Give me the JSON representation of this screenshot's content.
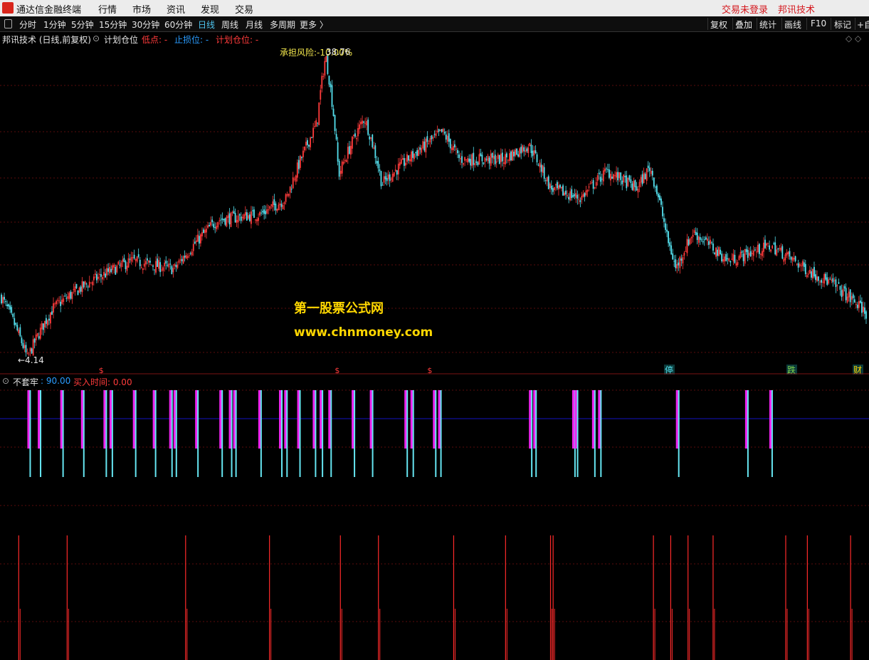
{
  "menubar": {
    "app_title": "通达信金融终端",
    "items": [
      "行情",
      "市场",
      "资讯",
      "发现",
      "交易"
    ],
    "right_items": [
      "交易未登录",
      "邦讯技术"
    ]
  },
  "toolbar": {
    "periods": [
      "分时",
      "1分钟",
      "5分钟",
      "15分钟",
      "30分钟",
      "60分钟",
      "日线",
      "周线",
      "月线",
      "多周期",
      "更多 〉"
    ],
    "active_period": "日线",
    "buttons": [
      "复权",
      "叠加",
      "统计",
      "画线",
      "F10",
      "标记",
      "+自"
    ]
  },
  "infobar": {
    "title": "邦讯技术 (日线,前复权)",
    "indicator": "计划仓位",
    "low_label": "低点: -",
    "stop_label": "止损位: -",
    "plan_label": "计划仓位: -",
    "diamonds": "◇ ◇"
  },
  "annotations": {
    "risk": "承担风险:-10.00%",
    "high_price": "38.76",
    "low_price": "←4.14",
    "watermark_line1": "第一股票公式网",
    "watermark_line2": "www.chnmoney.com",
    "signal_s": "$",
    "signal_labels": [
      "停",
      "跌",
      "财"
    ]
  },
  "indicator_panel": {
    "name": "不套牢",
    "value": ": 90.00",
    "buy_label": "买入时间: 0.00"
  },
  "colors": {
    "up": "#ff3b3b",
    "down": "#54e0ee",
    "magenta": "#ee22ee",
    "cyan": "#66e6f2",
    "red_spike": "#ff2a2a",
    "grid": "#5a0b0b",
    "blue_line": "#1414c0",
    "annotation_yellow": "#f2e64c"
  },
  "chart_data": {
    "type": "candlestick",
    "price_high": 38.76,
    "price_low": 4.14,
    "trend_keypoints": [
      [
        0,
        6.5
      ],
      [
        0.03,
        4.14
      ],
      [
        0.06,
        6.0
      ],
      [
        0.1,
        7.2
      ],
      [
        0.15,
        8.5
      ],
      [
        0.2,
        8.0
      ],
      [
        0.25,
        11.5
      ],
      [
        0.3,
        12.0
      ],
      [
        0.33,
        13.5
      ],
      [
        0.35,
        19.0
      ],
      [
        0.365,
        23.5
      ],
      [
        0.375,
        38.76
      ],
      [
        0.39,
        16.0
      ],
      [
        0.42,
        24.5
      ],
      [
        0.44,
        15.0
      ],
      [
        0.47,
        18.0
      ],
      [
        0.51,
        22.0
      ],
      [
        0.53,
        18.0
      ],
      [
        0.58,
        18.0
      ],
      [
        0.61,
        20.0
      ],
      [
        0.635,
        14.5
      ],
      [
        0.67,
        13.5
      ],
      [
        0.7,
        16.5
      ],
      [
        0.735,
        14.5
      ],
      [
        0.75,
        17.0
      ],
      [
        0.77,
        10.0
      ],
      [
        0.78,
        8.0
      ],
      [
        0.8,
        10.5
      ],
      [
        0.82,
        9.5
      ],
      [
        0.84,
        8.5
      ],
      [
        0.89,
        9.5
      ],
      [
        0.93,
        8.0
      ],
      [
        0.96,
        7.2
      ],
      [
        1.0,
        5.8
      ]
    ],
    "s_signal_positions": [
      0.115,
      0.388,
      0.495
    ],
    "indicator_bars": [
      0.03,
      0.042,
      0.068,
      0.092,
      0.118,
      0.125,
      0.152,
      0.175,
      0.194,
      0.199,
      0.224,
      0.252,
      0.263,
      0.268,
      0.297,
      0.321,
      0.327,
      0.342,
      0.36,
      0.368,
      0.378,
      0.405,
      0.426,
      0.466,
      0.473,
      0.499,
      0.505,
      0.61,
      0.615,
      0.66,
      0.663,
      0.683,
      0.69,
      0.78,
      0.86,
      0.888
    ],
    "red_spikes": [
      0.02,
      0.076,
      0.213,
      0.31,
      0.392,
      0.436,
      0.523,
      0.583,
      0.635,
      0.638,
      0.754,
      0.774,
      0.794,
      0.823,
      0.907,
      0.932,
      0.982
    ]
  }
}
